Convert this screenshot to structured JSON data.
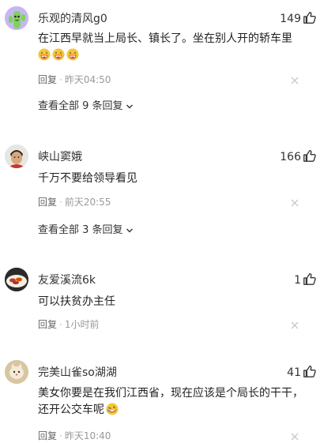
{
  "comments": [
    {
      "username": "乐观的清风g0",
      "likes": "149",
      "text": "在江西早就当上局长、镇长了。坐在别人开的轿车里",
      "emoji_count": 3,
      "reply_label": "回复",
      "time": "昨天04:50",
      "view_all": "查看全部 9 条回复",
      "avatar": "cactus-avatar"
    },
    {
      "username": "峡山窦娥",
      "likes": "166",
      "text": "千万不要给领导看见",
      "reply_label": "回复",
      "time": "前天20:55",
      "view_all": "查看全部 3 条回复",
      "avatar": "man-avatar"
    },
    {
      "username": "友爱溪流6k",
      "likes": "1",
      "text": "可以扶贫办主任",
      "reply_label": "回复",
      "time": "1小时前",
      "avatar": "food-avatar"
    },
    {
      "username": "完美山雀so湖湖",
      "likes": "41",
      "text": "美女你要是在我们江西省，现在应该是个局长的干干，还开公交车呢",
      "reply_label": "回复",
      "time": "昨天10:40",
      "avatar": "cat-avatar"
    }
  ],
  "colors": {
    "meta_gray": "#999999",
    "text": "#222222"
  }
}
